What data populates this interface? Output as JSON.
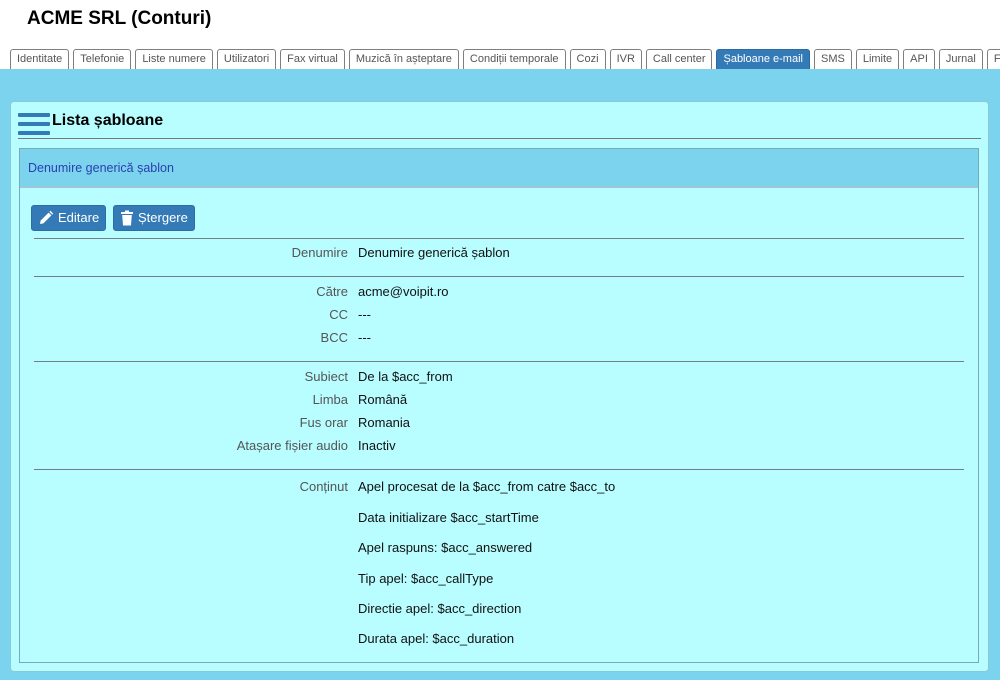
{
  "page": {
    "title": "ACME SRL (Conturi)"
  },
  "tabs": [
    {
      "label": "Identitate"
    },
    {
      "label": "Telefonie"
    },
    {
      "label": "Liste numere"
    },
    {
      "label": "Utilizatori"
    },
    {
      "label": "Fax virtual"
    },
    {
      "label": "Muzică în așteptare"
    },
    {
      "label": "Condiții temporale"
    },
    {
      "label": "Cozi"
    },
    {
      "label": "IVR"
    },
    {
      "label": "Call center"
    },
    {
      "label": "Șabloane e-mail"
    },
    {
      "label": "SMS"
    },
    {
      "label": "Limite"
    },
    {
      "label": "API"
    },
    {
      "label": "Jurnal"
    },
    {
      "label": "Facturare"
    }
  ],
  "active_tab": "Șabloane e-mail",
  "panel": {
    "title": "Lista șabloane"
  },
  "template": {
    "header": "Denumire generică șablon",
    "edit_label": "Editare",
    "delete_label": "Ștergere",
    "fields": {
      "name": {
        "label": "Denumire",
        "value": "Denumire generică șablon"
      },
      "to": {
        "label": "Către",
        "value": "acme@voipit.ro"
      },
      "cc": {
        "label": "CC",
        "value": "---"
      },
      "bcc": {
        "label": "BCC",
        "value": "---"
      },
      "subject": {
        "label": "Subiect",
        "value": "De la $acc_from"
      },
      "language": {
        "label": "Limba",
        "value": "Română"
      },
      "timezone": {
        "label": "Fus orar",
        "value": "Romania"
      },
      "audio": {
        "label": "Atașare fișier audio",
        "value": "Inactiv"
      },
      "content": {
        "label": "Conținut",
        "lines": [
          "Apel procesat de la $acc_from catre $acc_to",
          "Data initializare $acc_startTime",
          "Apel raspuns: $acc_answered",
          "Tip apel: $acc_callType",
          "Directie apel: $acc_direction",
          "Durata apel: $acc_duration"
        ]
      }
    }
  },
  "icons": {
    "menu": "hamburger-icon",
    "edit": "pencil-icon",
    "delete": "trash-icon"
  },
  "colors": {
    "accent": "#337ab7",
    "band": "#7cd3ee",
    "panel": "#b8fdff",
    "link": "#2a3fb0"
  }
}
